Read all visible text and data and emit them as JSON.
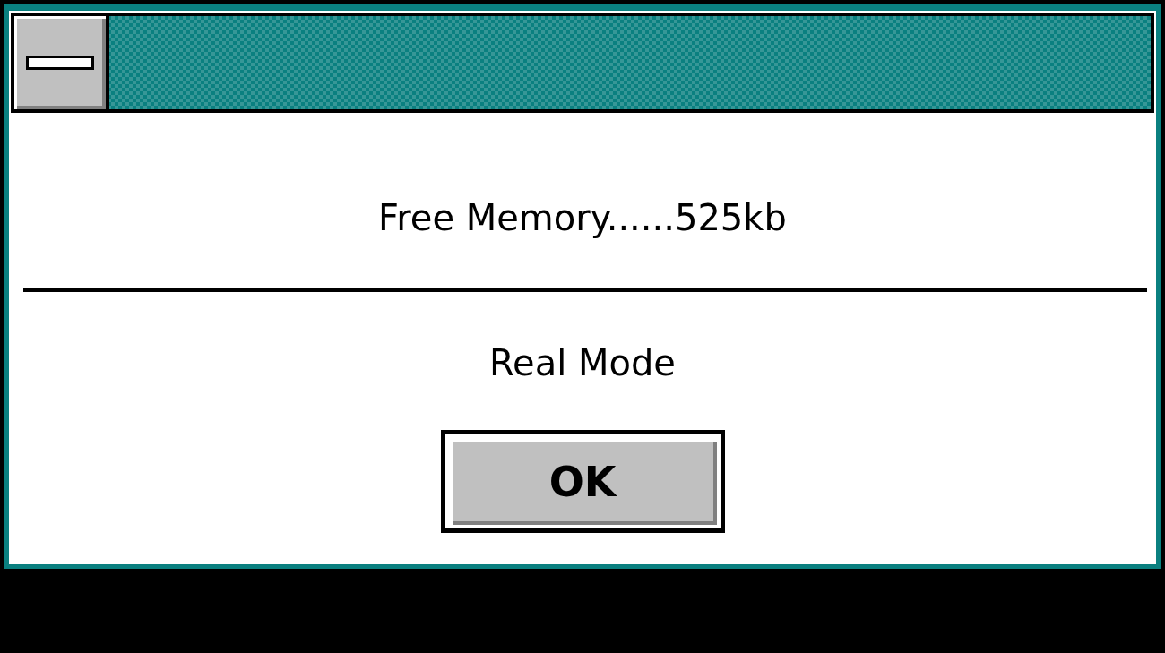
{
  "dialog": {
    "message": "Free Memory......525kb",
    "mode": "Real Mode"
  },
  "buttons": [
    {
      "label": "OK",
      "default": true
    }
  ]
}
